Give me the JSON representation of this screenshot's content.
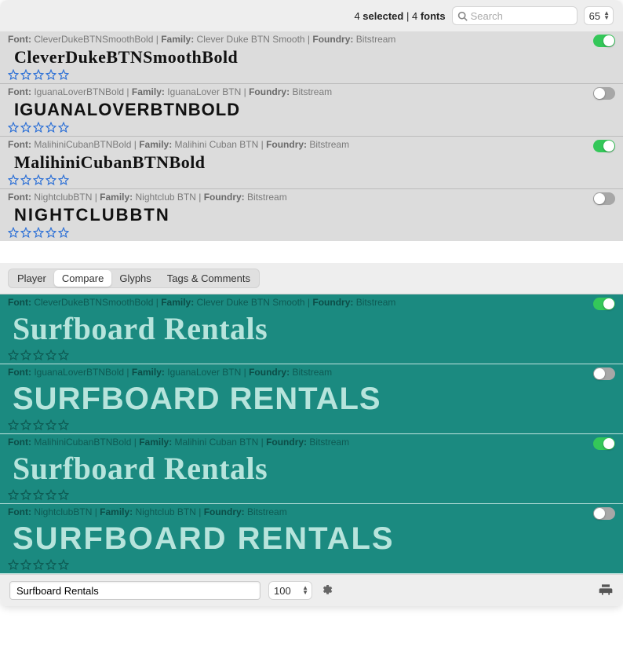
{
  "toolbar": {
    "selected_prefix_number": "4",
    "selected_prefix_label": "selected",
    "separator": " | ",
    "count_number": "4",
    "count_label": "fonts",
    "search_placeholder": "Search",
    "size_value": "65"
  },
  "labels": {
    "font": "Font:",
    "family": "Family:",
    "foundry": "Foundry:"
  },
  "fonts": [
    {
      "name": "CleverDukeBTNSmoothBold",
      "family": "Clever Duke BTN Smooth",
      "foundry": "Bitstream",
      "preview": "CleverDukeBTNSmoothBold",
      "enabled": true,
      "font_class": "f-clever"
    },
    {
      "name": "IguanaLoverBTNBold",
      "family": "IguanaLover BTN",
      "foundry": "Bitstream",
      "preview": "IguanaLoverBTNBold",
      "enabled": false,
      "font_class": "f-iguana"
    },
    {
      "name": "MalihiniCubanBTNBold",
      "family": "Malihini Cuban BTN",
      "foundry": "Bitstream",
      "preview": "MalihiniCubanBTNBold",
      "enabled": true,
      "font_class": "f-malihini"
    },
    {
      "name": "NightclubBTN",
      "family": "Nightclub BTN",
      "foundry": "Bitstream",
      "preview": "NightclubBTN",
      "enabled": false,
      "font_class": "f-nightclub"
    }
  ],
  "tabs": {
    "items": [
      "Player",
      "Compare",
      "Glyphs",
      "Tags & Comments"
    ],
    "active_index": 1
  },
  "compare": {
    "sample_text": "Surfboard Rentals",
    "rows": [
      {
        "name": "CleverDukeBTNSmoothBold",
        "family": "Clever Duke BTN Smooth",
        "foundry": "Bitstream",
        "enabled": true,
        "font_class": "f-clever"
      },
      {
        "name": "IguanaLoverBTNBold",
        "family": "IguanaLover BTN",
        "foundry": "Bitstream",
        "enabled": false,
        "font_class": "f-iguana"
      },
      {
        "name": "MalihiniCubanBTNBold",
        "family": "Malihini Cuban BTN",
        "foundry": "Bitstream",
        "enabled": true,
        "font_class": "f-malihini"
      },
      {
        "name": "NightclubBTN",
        "family": "Nightclub BTN",
        "foundry": "Bitstream",
        "enabled": false,
        "font_class": "f-nightclub"
      }
    ]
  },
  "footer": {
    "sample_value": "Surfboard Rentals",
    "size_value": "100"
  },
  "colors": {
    "teal_bg": "#1b8a80",
    "teal_text": "#b7e4dc",
    "star_stroke_top": "#2b6fd6",
    "star_stroke_compare": "#0e5a53",
    "toggle_on": "#34c759",
    "toggle_off": "#a7a7a7"
  }
}
